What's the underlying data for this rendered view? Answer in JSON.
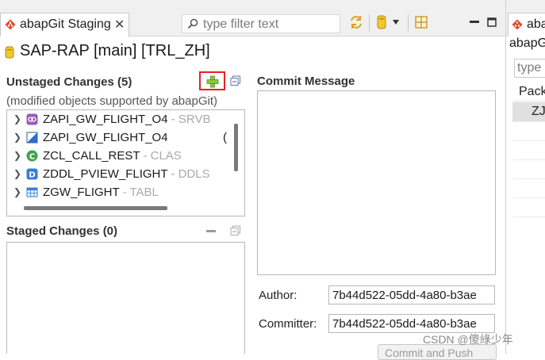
{
  "tab": {
    "label": "abapGit Staging",
    "close": "✕"
  },
  "toolbar": {
    "filter_placeholder": "type filter text",
    "icons": [
      "sync-icon",
      "repository-icon",
      "dropdown-icon",
      "table-icon",
      "minimize-icon",
      "maximize-icon"
    ]
  },
  "repository": {
    "title": "SAP-RAP [main] [TRL_ZH]"
  },
  "unstaged": {
    "title": "Unstaged Changes (5)",
    "subtitle": "(modified objects supported by abapGit)",
    "items": [
      {
        "name": "ZAPI_GW_FLIGHT_O4",
        "type": "SRVB",
        "icon": "service-binding-icon"
      },
      {
        "name": "ZAPI_GW_FLIGHT_O4",
        "type": "",
        "icon": "service-definition-icon"
      },
      {
        "name": "ZCL_CALL_REST",
        "type": "CLAS",
        "icon": "class-icon"
      },
      {
        "name": "ZDDL_PVIEW_FLIGHT",
        "type": "DDLS",
        "icon": "ddl-source-icon"
      },
      {
        "name": "ZGW_FLIGHT",
        "type": "TABL",
        "icon": "table-icon"
      }
    ],
    "sep": " - ",
    "clipped_char": "("
  },
  "staged": {
    "title": "Staged Changes (0)"
  },
  "commit": {
    "title": "Commit Message",
    "author_label": "Author:",
    "author_value": "7b44d522-05dd-4a80-b3ae",
    "committer_label": "Committer:",
    "committer_value": "7b44d522-05dd-4a80-b3ae",
    "button_label": "Commit and Push"
  },
  "right_pane": {
    "tab_label": "aba",
    "title": "abapG",
    "filter_placeholder": "type",
    "column_header": "Pack",
    "row_value": "ZJA"
  },
  "watermark": "CSDN @傻綠少年",
  "colors": {
    "highlight": "#e8202a",
    "selection": "#e0e0e0",
    "plus": "#8cc63e"
  }
}
